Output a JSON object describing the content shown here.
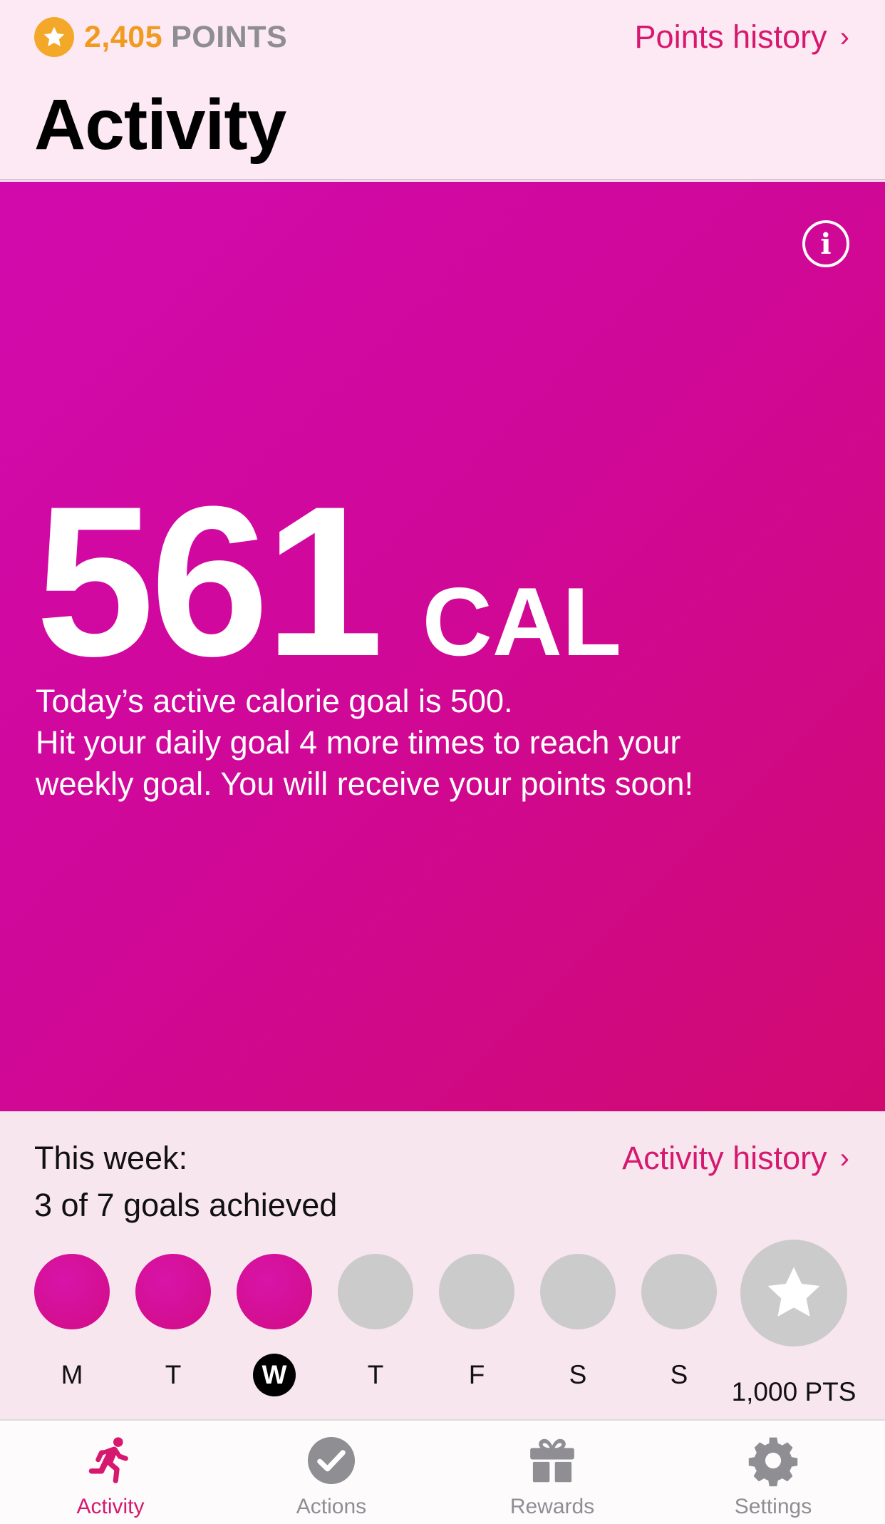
{
  "header": {
    "points_value": "2,405",
    "points_label": "POINTS",
    "points_history_label": "Points history",
    "title": "Activity"
  },
  "hero": {
    "value": "561",
    "unit": "CAL",
    "description_lines": [
      "Today’s active calorie goal is 500.",
      "Hit your daily goal 4 more times to reach your",
      "weekly goal. You will receive your points soon!"
    ]
  },
  "week": {
    "label": "This week:",
    "goals_text": "3 of 7 goals achieved",
    "history_label": "Activity history",
    "days": [
      {
        "letter": "M",
        "achieved": true,
        "today": false
      },
      {
        "letter": "T",
        "achieved": true,
        "today": false
      },
      {
        "letter": "W",
        "achieved": true,
        "today": true
      },
      {
        "letter": "T",
        "achieved": false,
        "today": false
      },
      {
        "letter": "F",
        "achieved": false,
        "today": false
      },
      {
        "letter": "S",
        "achieved": false,
        "today": false
      },
      {
        "letter": "S",
        "achieved": false,
        "today": false
      }
    ],
    "reward_label": "1,000 PTS"
  },
  "tabs": [
    {
      "label": "Activity",
      "icon": "running-figure-icon",
      "active": true
    },
    {
      "label": "Actions",
      "icon": "checkmark-circle-icon",
      "active": false
    },
    {
      "label": "Rewards",
      "icon": "gift-icon",
      "active": false
    },
    {
      "label": "Settings",
      "icon": "gear-icon",
      "active": false
    }
  ],
  "colors": {
    "accent": "#d6186e",
    "points_gold": "#f09a1f",
    "hero_start": "#d20aad",
    "hero_end": "#d10a71",
    "inactive_circle": "#cbcbcb"
  }
}
